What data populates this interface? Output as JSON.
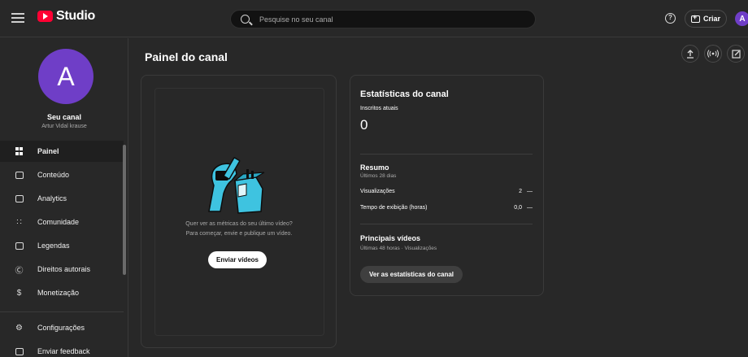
{
  "header": {
    "logo_text": "Studio",
    "search_placeholder": "Pesquise no seu canal",
    "help_glyph": "?",
    "create_label": "Criar",
    "avatar_letter": "A"
  },
  "channel": {
    "avatar_letter": "A",
    "name": "Seu canal",
    "handle": "Artur Vidal krause"
  },
  "sidebar": {
    "items": [
      {
        "label": "Painel",
        "icon": "dashboard-icon",
        "active": true
      },
      {
        "label": "Conteúdo",
        "icon": "content-icon"
      },
      {
        "label": "Analytics",
        "icon": "analytics-icon"
      },
      {
        "label": "Comunidade",
        "icon": "community-icon"
      },
      {
        "label": "Legendas",
        "icon": "subtitles-icon"
      },
      {
        "label": "Direitos autorais",
        "icon": "copyright-icon"
      },
      {
        "label": "Monetização",
        "icon": "dollar-icon"
      },
      {
        "label": "Configurações",
        "icon": "gear-icon"
      },
      {
        "label": "Enviar feedback",
        "icon": "feedback-icon"
      }
    ]
  },
  "main": {
    "title": "Painel do canal",
    "video_card": {
      "line1": "Quer ver as métricas do seu último vídeo?",
      "line2": "Para começar, envie e publique um vídeo.",
      "button": "Enviar vídeos"
    },
    "stats_card": {
      "title": "Estatísticas do canal",
      "subs_label": "Inscritos atuais",
      "subs_value": "0",
      "summary_title": "Resumo",
      "summary_period": "Últimos 28 dias",
      "metrics": [
        {
          "label": "Visualizações",
          "value": "2",
          "trend": "—"
        },
        {
          "label": "Tempo de exibição (horas)",
          "value": "0,0",
          "trend": "—"
        }
      ],
      "top_title": "Principais vídeos",
      "top_sub": "Últimas 48 horas · Visualizações",
      "button": "Ver as estatísticas do canal"
    }
  },
  "colors": {
    "background": "#282828",
    "accent_red": "#ff0033",
    "avatar_purple": "#6f3ec7",
    "illustration_cyan": "#3ec3e0"
  }
}
